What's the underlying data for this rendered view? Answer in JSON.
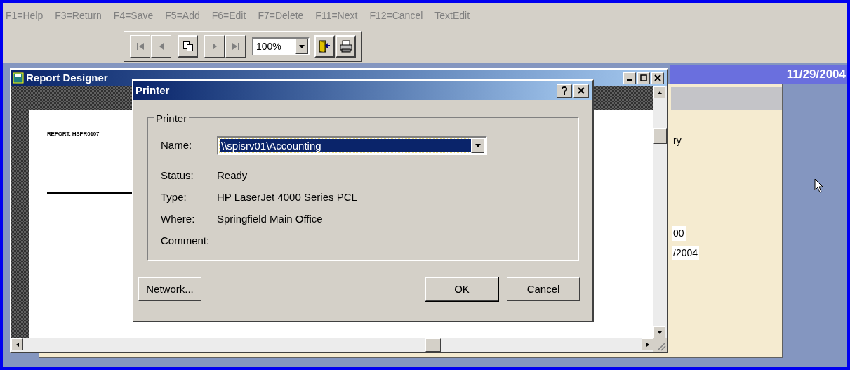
{
  "menu": [
    {
      "label": "F1=Help"
    },
    {
      "label": "F3=Return"
    },
    {
      "label": "F4=Save"
    },
    {
      "label": "F5=Add"
    },
    {
      "label": "F6=Edit"
    },
    {
      "label": "F7=Delete"
    },
    {
      "label": "F11=Next"
    },
    {
      "label": "F12=Cancel"
    },
    {
      "label": "TextEdit"
    }
  ],
  "toolbar": [
    {
      "kind": "first",
      "disabled": true
    },
    {
      "kind": "prev",
      "disabled": true
    },
    {
      "kind": "copy",
      "disabled": false
    },
    {
      "kind": "next",
      "disabled": true
    },
    {
      "kind": "last",
      "disabled": true
    },
    {
      "kind": "zoom",
      "value": "100%"
    },
    {
      "kind": "exit",
      "disabled": false
    },
    {
      "kind": "print",
      "disabled": false
    }
  ],
  "app": {
    "date": "11/29/2004",
    "fragments": [
      {
        "text": "ry",
        "boxed": false
      },
      {
        "text": "00",
        "boxed": true
      },
      {
        "text": "/2004",
        "boxed": true
      }
    ]
  },
  "report_window": {
    "title": "Report Designer",
    "page_text": "REPORT: HSPR0107"
  },
  "dialog": {
    "title": "Printer",
    "group": "Printer",
    "name_label": "Name:",
    "name_value": "\\\\spisrv01\\Accounting",
    "fields": [
      {
        "label": "Status:",
        "value": "Ready"
      },
      {
        "label": "Type:",
        "value": "HP LaserJet 4000 Series PCL"
      },
      {
        "label": "Where:",
        "value": "Springfield Main Office"
      },
      {
        "label": "Comment:"
      }
    ],
    "buttons": [
      {
        "label": "Network...",
        "default": false
      },
      {
        "label": "OK",
        "default": true
      },
      {
        "label": "Cancel",
        "default": false
      }
    ]
  }
}
